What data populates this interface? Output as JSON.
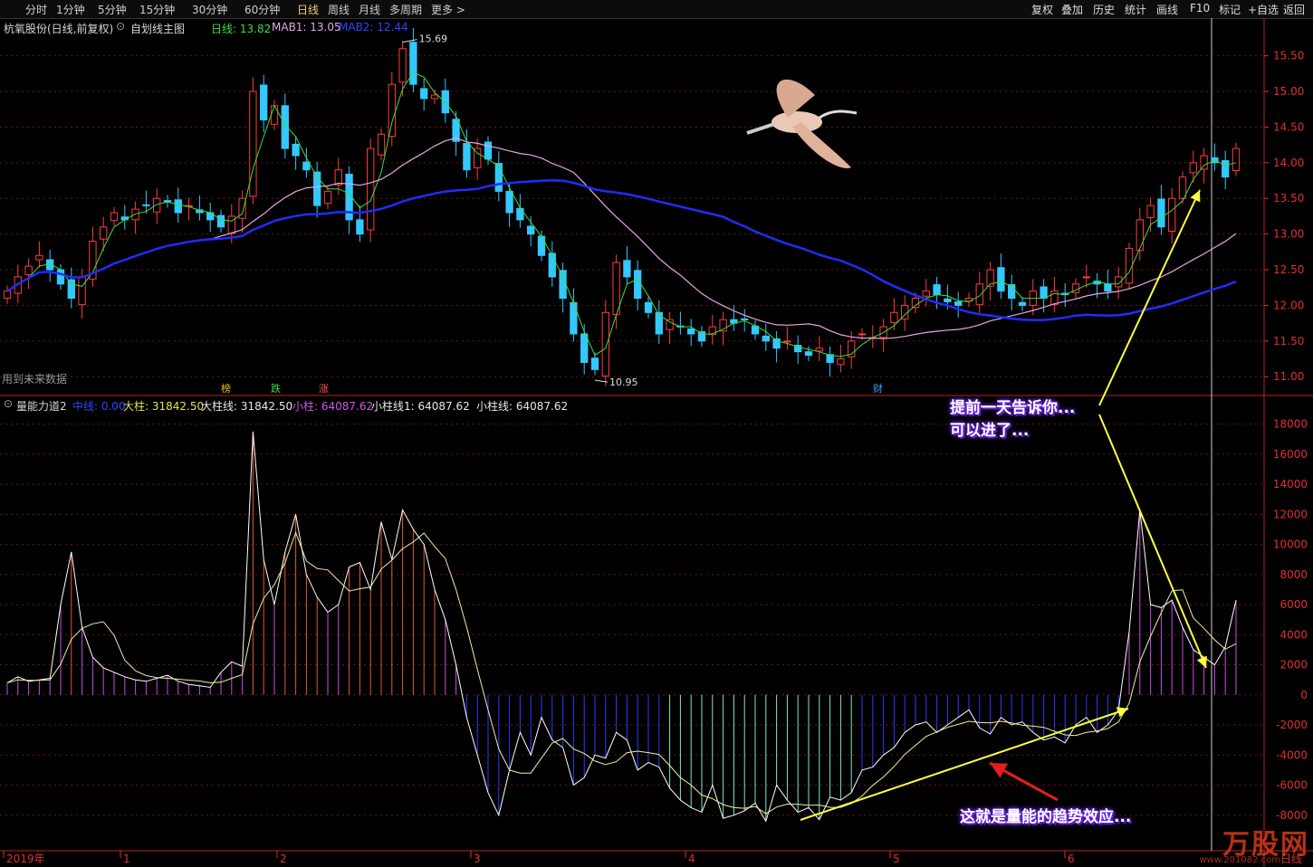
{
  "toolbar": {
    "left_items": [
      "分时",
      "1分钟",
      "5分钟",
      "15分钟",
      "30分钟",
      "60分钟",
      "日线",
      "周线",
      "月线",
      "多周期",
      "更多 >"
    ],
    "active": "日线",
    "right_items": [
      "复权",
      "叠加",
      "历史",
      "统计",
      "画线",
      "F10",
      "标记",
      "+自选",
      "返回"
    ]
  },
  "main_panel": {
    "stock_label": "杭氧股份(日线,前复权)",
    "formula_label": "自划线主图",
    "ma_label_1": "日线: 13.82",
    "ma_label_2": "MAB1: 13.05",
    "ma_label_3": "MAB2: 12.44",
    "future_note": "用到未来数据",
    "high_mark": "15.69",
    "low_mark": "10.95",
    "event_marks": [
      "榜",
      "跌",
      "涨",
      "财"
    ]
  },
  "indicator_panel": {
    "title": "量能力道2",
    "labels": [
      "中线: 0.00",
      "大柱: 31842.50",
      "大柱线: 31842.50",
      "小柱: 64087.62",
      "小柱线1: 64087.62",
      "小柱线: 64087.62"
    ]
  },
  "annotations": {
    "top_line1": "提前一天告诉你...",
    "top_line2": "可以进了...",
    "bottom": "这就是量能的趋势效应..."
  },
  "watermark": {
    "main": "万股网",
    "sub": "www.201082.com"
  },
  "colors": {
    "up": "#ff3c3c",
    "down": "#33c8ff",
    "ma_fast": "#3adf3a",
    "ma_mid": "#e7a6e7",
    "ma_slow": "#1f2dff",
    "grid": "#8a1414",
    "axis": "#e03030"
  },
  "chart_data": [
    {
      "type": "candlestick",
      "title": "杭氧股份(日线,前复权)",
      "ylim": [
        10.8,
        15.8
      ],
      "y_ticks": [
        11.0,
        11.5,
        12.0,
        12.5,
        13.0,
        13.5,
        14.0,
        14.5,
        15.0,
        15.5
      ],
      "x_month_labels": [
        "2019年",
        "1",
        "2",
        "3",
        "4",
        "5",
        "6"
      ],
      "close": [
        12.2,
        12.4,
        12.55,
        12.7,
        12.5,
        12.3,
        12.1,
        12.4,
        12.9,
        13.1,
        13.3,
        13.2,
        13.35,
        13.4,
        13.5,
        13.45,
        13.3,
        13.4,
        13.3,
        13.2,
        13.1,
        13.25,
        13.5,
        15.0,
        14.6,
        14.8,
        14.2,
        14.1,
        13.9,
        13.4,
        13.6,
        13.9,
        13.2,
        13.0,
        14.2,
        14.4,
        15.1,
        15.6,
        15.1,
        14.9,
        14.95,
        14.7,
        14.3,
        13.9,
        14.2,
        14.05,
        13.6,
        13.3,
        13.2,
        13.0,
        12.7,
        12.4,
        12.1,
        11.6,
        11.2,
        11.1,
        11.9,
        12.6,
        12.4,
        12.1,
        11.9,
        11.6,
        11.8,
        11.7,
        11.6,
        11.5,
        11.7,
        11.8,
        11.75,
        11.8,
        11.6,
        11.5,
        11.4,
        11.5,
        11.35,
        11.3,
        11.4,
        11.2,
        11.25,
        11.5,
        11.6,
        11.55,
        11.7,
        11.9,
        12.0,
        12.1,
        12.2,
        12.15,
        12.05,
        12.0,
        12.1,
        12.3,
        12.5,
        12.2,
        12.1,
        12.0,
        12.2,
        12.1,
        12.2,
        12.15,
        12.3,
        12.4,
        12.3,
        12.2,
        12.4,
        12.8,
        13.2,
        13.4,
        13.1,
        13.5,
        13.8,
        14.0,
        14.1,
        14.0,
        13.8,
        14.2
      ],
      "series": [
        {
          "name": "日线",
          "value_last": 13.82
        },
        {
          "name": "MAB1",
          "value_last": 13.05
        },
        {
          "name": "MAB2",
          "value_last": 12.44
        }
      ],
      "high": 15.69,
      "low": 10.95
    },
    {
      "type": "bar",
      "title": "量能力道2",
      "ylim": [
        -10000,
        19000
      ],
      "y_ticks": [
        -8000,
        -6000,
        -4000,
        -2000,
        0,
        2000,
        4000,
        6000,
        8000,
        10000,
        12000,
        14000,
        16000,
        18000
      ],
      "series": [
        {
          "name": "大柱",
          "value_last": 31842.5
        },
        {
          "name": "小柱",
          "value_last": 64087.62
        }
      ],
      "values": [
        800,
        1200,
        900,
        1000,
        1100,
        6000,
        9500,
        4500,
        2500,
        1800,
        1500,
        1200,
        1000,
        900,
        1100,
        1300,
        900,
        700,
        600,
        500,
        1500,
        2200,
        1900,
        17500,
        9000,
        6000,
        9500,
        12000,
        8000,
        6500,
        5500,
        6000,
        8500,
        8800,
        7000,
        11500,
        9000,
        12300,
        11000,
        10000,
        7000,
        5000,
        2000,
        -1500,
        -4000,
        -6500,
        -8000,
        -5000,
        -2500,
        -4000,
        -1500,
        -3000,
        -3500,
        -6000,
        -5500,
        -4000,
        -4200,
        -2500,
        -3000,
        -5000,
        -4500,
        -4800,
        -6200,
        -7000,
        -7500,
        -7800,
        -6000,
        -8200,
        -8000,
        -7700,
        -7200,
        -8400,
        -6000,
        -7000,
        -7800,
        -7500,
        -8300,
        -6800,
        -7000,
        -6500,
        -5000,
        -4800,
        -4000,
        -3500,
        -2500,
        -2000,
        -1800,
        -2500,
        -2000,
        -1500,
        -1000,
        -2200,
        -2600,
        -1500,
        -2000,
        -1800,
        -2500,
        -3000,
        -2800,
        -3200,
        -2000,
        -1500,
        -2500,
        -2000,
        -1000,
        4200,
        12300,
        6000,
        5800,
        6300,
        4500,
        3000,
        2500,
        2000,
        3200,
        6300
      ]
    }
  ]
}
